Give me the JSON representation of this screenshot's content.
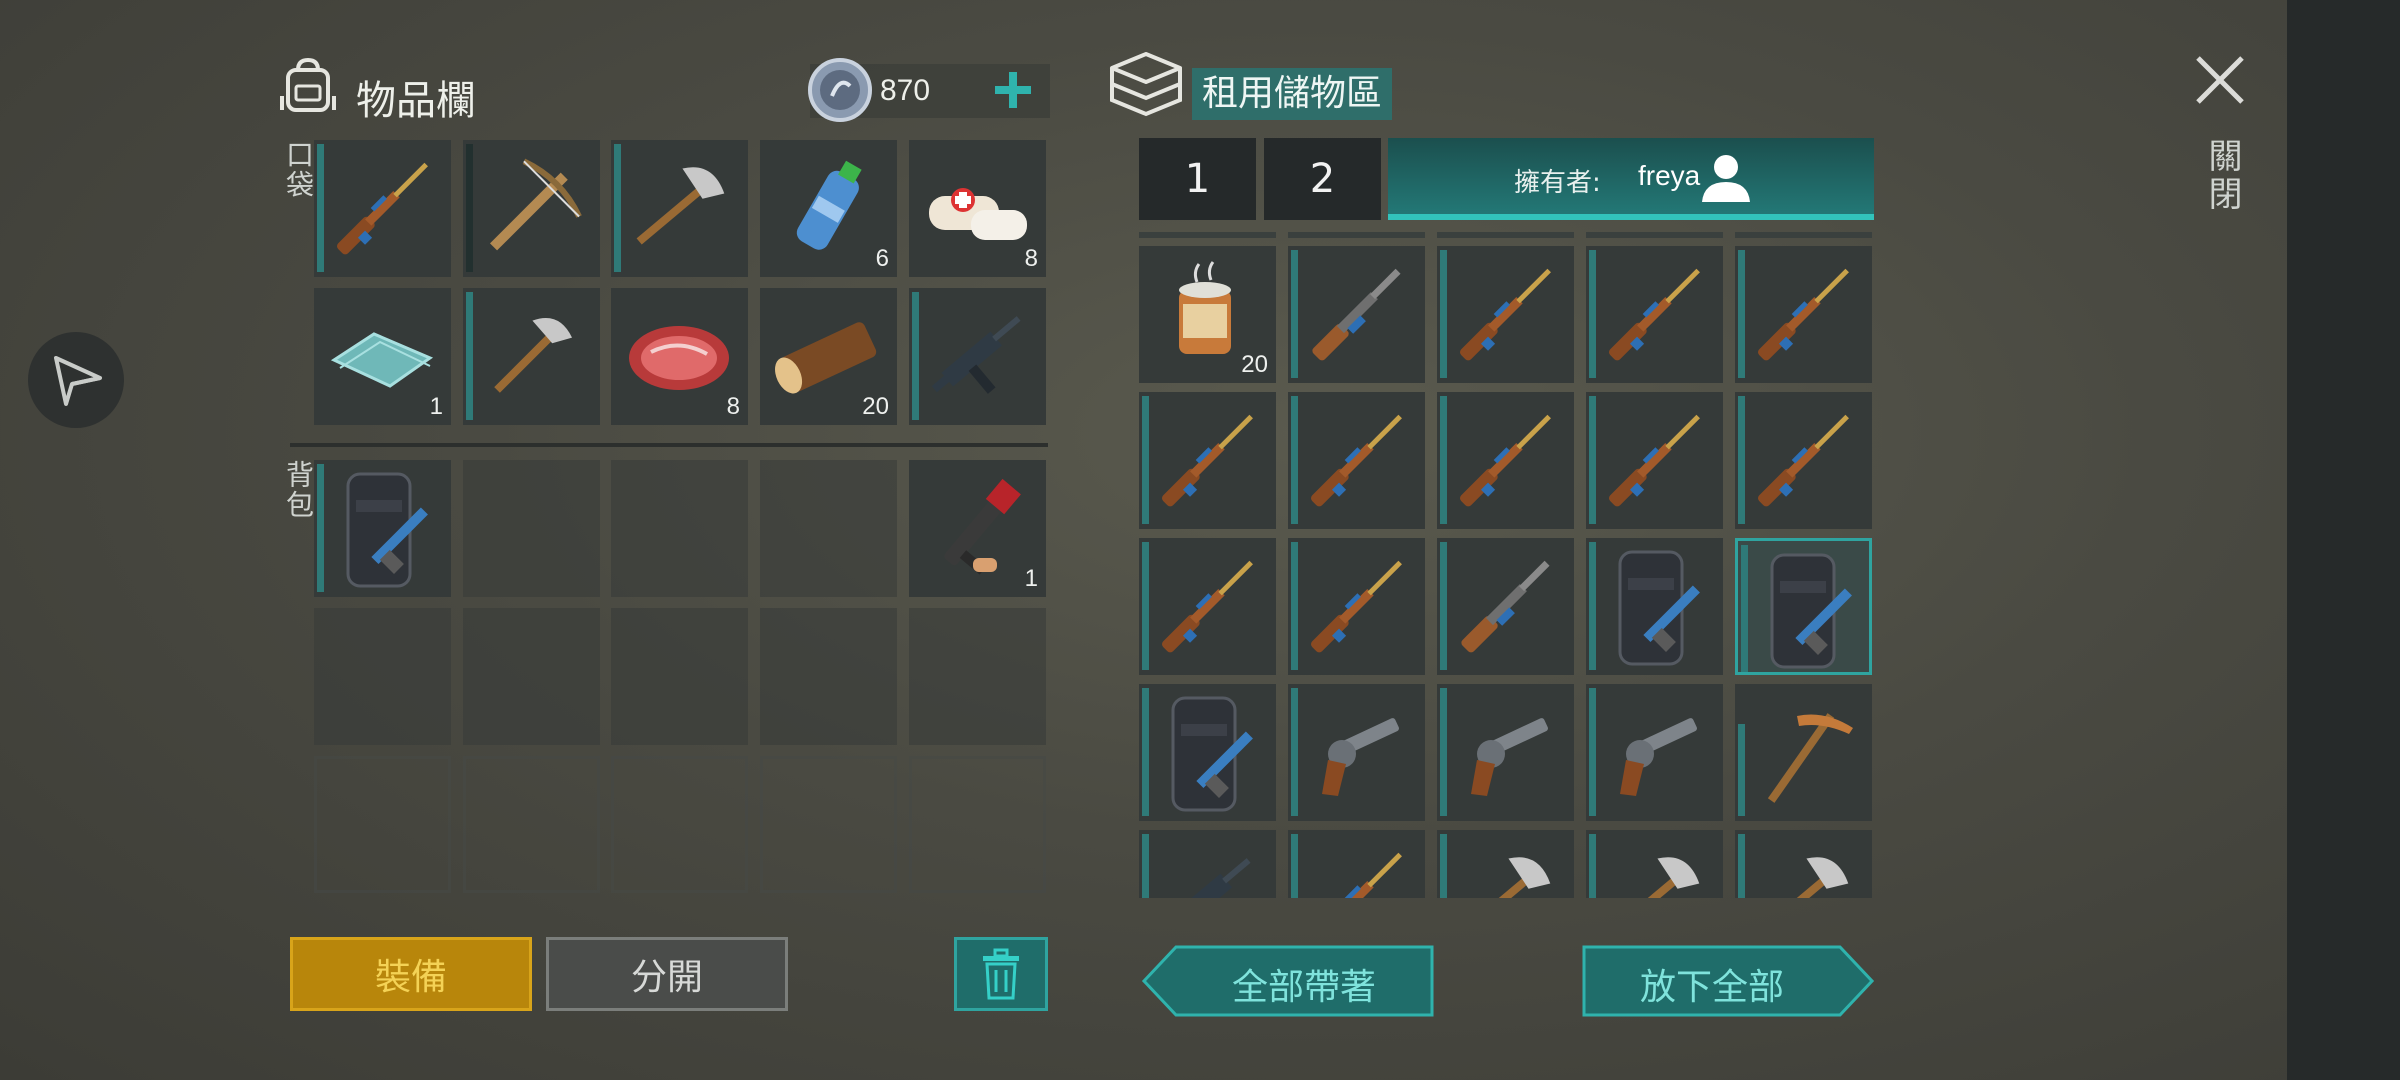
{
  "inventory": {
    "title": "物品欄",
    "currency": "870",
    "pocket_label": "口袋",
    "backpack_label": "背包",
    "pocket_slots": [
      {
        "icon": "rifle-icon",
        "count": ""
      },
      {
        "icon": "crossbow-icon",
        "count": ""
      },
      {
        "icon": "axe-icon",
        "count": ""
      },
      {
        "icon": "water-bottle-icon",
        "count": "6"
      },
      {
        "icon": "bandage-icon",
        "count": "8"
      },
      {
        "icon": "glass-sheets-icon",
        "count": "1"
      },
      {
        "icon": "hatchet-icon",
        "count": ""
      },
      {
        "icon": "raw-meat-icon",
        "count": "8"
      },
      {
        "icon": "wood-log-icon",
        "count": "20"
      },
      {
        "icon": "smg-icon",
        "count": ""
      }
    ],
    "backpack_slots": [
      {
        "icon": "riot-shield-icon",
        "count": ""
      },
      {
        "icon": "empty",
        "count": ""
      },
      {
        "icon": "empty",
        "count": ""
      },
      {
        "icon": "empty",
        "count": ""
      },
      {
        "icon": "grenade-launcher-icon",
        "count": "1"
      }
    ],
    "equip_label": "裝備",
    "split_label": "分開"
  },
  "storage": {
    "title": "租用儲物區",
    "tabs": [
      "1",
      "2"
    ],
    "owner_label": "擁有者:",
    "owner_name": "freya",
    "take_all_label": "全部帶著",
    "put_all_label": "放下全部",
    "slots": [
      {
        "icon": "canned-stew-icon",
        "count": "20"
      },
      {
        "icon": "shotgun-icon",
        "count": ""
      },
      {
        "icon": "rifle-icon",
        "count": ""
      },
      {
        "icon": "rifle-icon",
        "count": ""
      },
      {
        "icon": "rifle-icon",
        "count": ""
      },
      {
        "icon": "rifle-icon",
        "count": ""
      },
      {
        "icon": "rifle-icon",
        "count": ""
      },
      {
        "icon": "rifle-icon",
        "count": ""
      },
      {
        "icon": "rifle-icon",
        "count": ""
      },
      {
        "icon": "rifle-icon",
        "count": ""
      },
      {
        "icon": "rifle-icon",
        "count": ""
      },
      {
        "icon": "rifle-icon",
        "count": ""
      },
      {
        "icon": "shotgun-icon",
        "count": ""
      },
      {
        "icon": "riot-shield-icon",
        "count": ""
      },
      {
        "icon": "riot-shield-icon",
        "count": ""
      },
      {
        "icon": "riot-shield-icon",
        "count": ""
      },
      {
        "icon": "revolver-icon",
        "count": ""
      },
      {
        "icon": "revolver-icon",
        "count": ""
      },
      {
        "icon": "revolver-icon",
        "count": ""
      },
      {
        "icon": "pickaxe-icon",
        "count": ""
      },
      {
        "icon": "smg-icon",
        "count": ""
      },
      {
        "icon": "rifle-icon",
        "count": ""
      },
      {
        "icon": "axe-icon",
        "count": ""
      },
      {
        "icon": "axe-icon",
        "count": ""
      },
      {
        "icon": "axe-icon",
        "count": ""
      }
    ]
  },
  "close_label": "關閉",
  "colors": {
    "accent": "#2fa4a0",
    "equip": "#b8860b",
    "background": "#4a4a42"
  }
}
